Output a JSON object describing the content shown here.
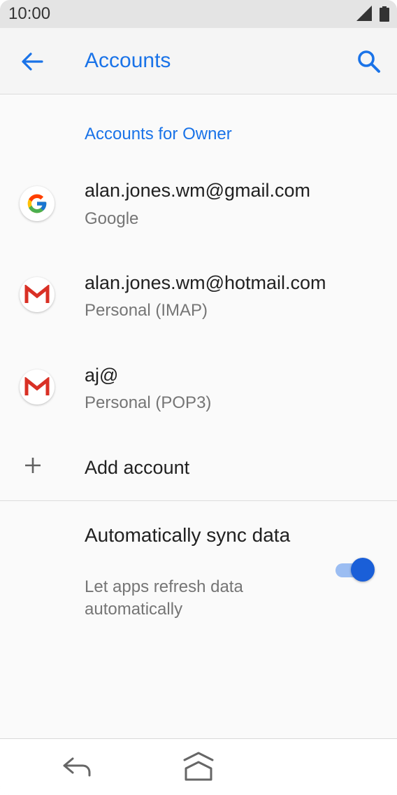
{
  "status_bar": {
    "time": "10:00",
    "signal_icon": "cell-signal-icon",
    "battery_icon": "battery-icon"
  },
  "app_bar": {
    "title": "Accounts",
    "back_icon": "arrow-back-icon",
    "search_icon": "search-icon"
  },
  "section_header": "Accounts for Owner",
  "accounts": [
    {
      "title": "alan.jones.wm@gmail.com",
      "subtitle": "Google",
      "icon": "google-icon"
    },
    {
      "title": "alan.jones.wm@hotmail.com",
      "subtitle": "Personal (IMAP)",
      "icon": "gmail-icon"
    },
    {
      "title": "aj@",
      "subtitle": "Personal (POP3)",
      "icon": "gmail-icon"
    }
  ],
  "add_account": {
    "label": "Add account",
    "icon": "plus-icon"
  },
  "auto_sync": {
    "title": "Automatically sync data",
    "subtitle": "Let apps refresh data automatically",
    "enabled": true
  },
  "colors": {
    "accent": "#1a73e8",
    "toggle_thumb": "#1a5fd8",
    "toggle_track": "#9bbdf2",
    "gmail_red": "#d93025"
  },
  "nav_bar": {
    "back_icon": "nav-back-icon",
    "home_icon": "nav-home-icon"
  }
}
